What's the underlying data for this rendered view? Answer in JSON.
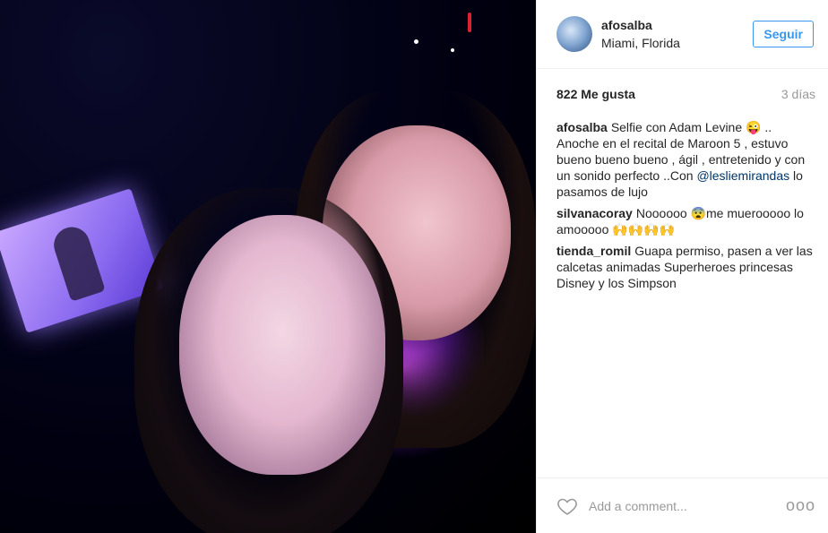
{
  "post": {
    "username": "afosalba",
    "location": "Miami, Florida",
    "follow_label": "Seguir",
    "likes": "822 Me gusta",
    "time": "3 días",
    "caption": {
      "user": "afosalba",
      "text_before": "Selfie con Adam Levine 😜 .. Anoche en el recital de Maroon 5 , estuvo bueno bueno bueno , ágil , entretenido y con un sonido perfecto ..Con ",
      "mention": "@lesliemirandas",
      "text_after": " lo pasamos de lujo"
    },
    "comments": [
      {
        "user": "silvanacoray",
        "text": "Noooooo 😨me muerooooo lo amooooo 🙌🙌🙌🙌"
      },
      {
        "user": "tienda_romil",
        "text": "Guapa permiso, pasen a ver las calcetas animadas Superheroes princesas Disney y los Simpson"
      }
    ],
    "add_comment_placeholder": "Add a comment...",
    "more_label": "ooo"
  },
  "colors": {
    "accent": "#3897f0",
    "muted": "#999999"
  },
  "icons": {
    "like": "heart-icon",
    "options": "more-options-icon"
  }
}
